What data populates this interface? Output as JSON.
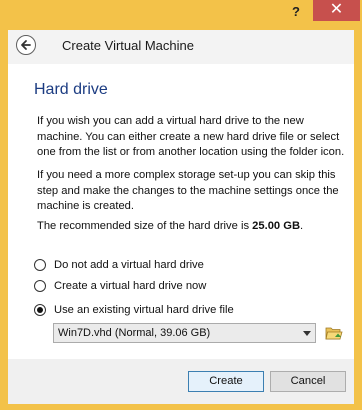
{
  "window": {
    "help_label": "?",
    "close_label": "✕"
  },
  "header": {
    "title": "Create Virtual Machine"
  },
  "page": {
    "title": "Hard drive",
    "para1": "If you wish you can add a virtual hard drive to the new machine. You can either create a new hard drive file or select one from the list or from another location using the folder icon.",
    "para2": "If you need a more complex storage set-up you can skip this step and make the changes to the machine settings once the machine is created.",
    "recommended_prefix": "The recommended size of the hard drive is ",
    "recommended_size": "25.00 GB",
    "recommended_suffix": "."
  },
  "options": [
    {
      "label": "Do not add a virtual hard drive",
      "checked": false
    },
    {
      "label": "Create a virtual hard drive now",
      "checked": false
    },
    {
      "label": "Use an existing virtual hard drive file",
      "checked": true
    }
  ],
  "disk_select": {
    "value": "Win7D.vhd (Normal, 39.06 GB)"
  },
  "footer": {
    "create_label": "Create",
    "cancel_label": "Cancel"
  },
  "colors": {
    "frame": "#f3c249",
    "title_text": "#1c3c82",
    "close_button": "#c7504d"
  },
  "icons": {
    "back": "back-arrow-icon",
    "folder": "folder-icon",
    "dropdown": "chevron-down-icon"
  }
}
